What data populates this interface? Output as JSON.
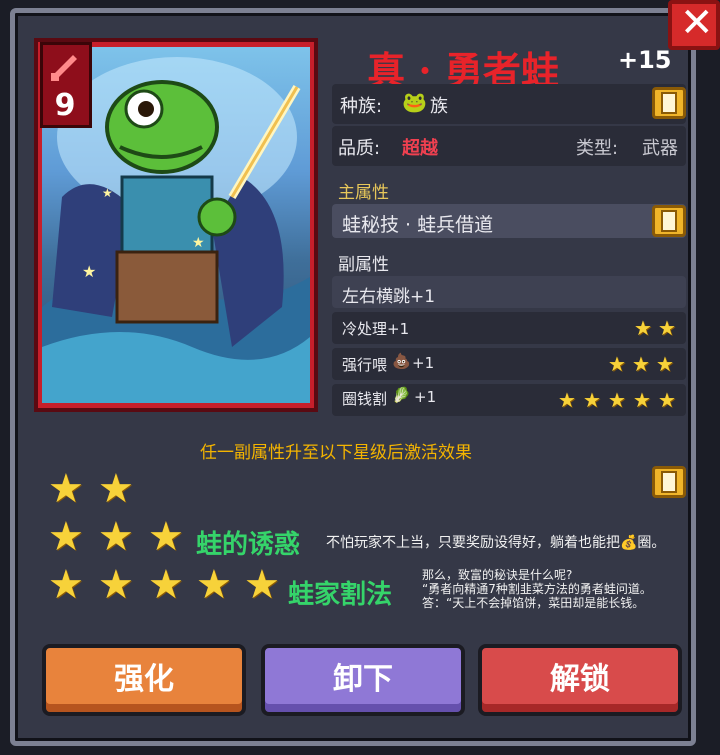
{
  "item": {
    "name": "真 · 勇者蛙",
    "level": "+15",
    "cost": "9",
    "race_label": "种族:",
    "race_value": "族",
    "quality_label": "品质:",
    "quality_value": "超越",
    "type_label": "类型:",
    "type_value": "武器"
  },
  "main_attr": {
    "heading": "主属性",
    "value": "蛙秘技 · 蛙兵借道"
  },
  "sub_attr": {
    "heading": "副属性",
    "items": [
      {
        "label": "左右横跳+1",
        "stars": 0
      },
      {
        "label": "冷处理+1",
        "stars": 2
      },
      {
        "label": "强行喂",
        "suffix": "+1",
        "stars": 3
      },
      {
        "label": "圈钱割",
        "suffix": "+1",
        "stars": 5
      }
    ]
  },
  "hint": "任一副属性升至以下星级后激活效果",
  "bonuses": [
    {
      "stars": 2,
      "name": "",
      "desc": ""
    },
    {
      "stars": 3,
      "name": "蛙的诱惑",
      "desc": "不怕玩家不上当，只要奖励设得好，躺着也能把💰圈。"
    },
    {
      "stars": 5,
      "name": "蛙家割法",
      "desc_lines": [
        "那么，致富的秘诀是什么呢?",
        "“勇者向精通7种割韭菜方法的勇者蛙问道。",
        "答：“天上不会掉馅饼，菜田却是能长钱。"
      ]
    }
  ],
  "buttons": {
    "upgrade": "强化",
    "unequip": "卸下",
    "unlock": "解锁"
  },
  "colors": {
    "title": "#e8232a",
    "quality": "#f04050",
    "bonus_name": "#35d46a",
    "hint": "#f4b400"
  },
  "icons": [
    "close-icon",
    "sword-icon",
    "frog-emoji-icon",
    "info-book-icon",
    "star-icon",
    "poop-icon",
    "leek-icon",
    "moneybag-icon"
  ]
}
